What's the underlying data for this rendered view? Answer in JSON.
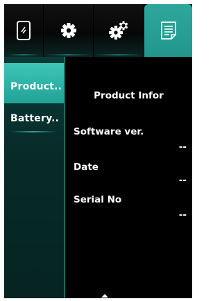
{
  "tabs": [
    {
      "icon": "phone-icon",
      "active": false
    },
    {
      "icon": "gear-icon",
      "active": false
    },
    {
      "icon": "gears-icon",
      "active": false
    },
    {
      "icon": "document-icon",
      "active": true
    }
  ],
  "sidebar": {
    "items": [
      {
        "label": "Product..",
        "active": true
      },
      {
        "label": "Battery..",
        "active": false
      }
    ]
  },
  "main": {
    "title": "Product Infor",
    "fields": [
      {
        "label": "Software ver.",
        "value": "--"
      },
      {
        "label": "Date",
        "value": "--"
      },
      {
        "label": "Serial No",
        "value": "--"
      }
    ]
  },
  "colors": {
    "accent": "#23968c",
    "background": "#000000"
  }
}
